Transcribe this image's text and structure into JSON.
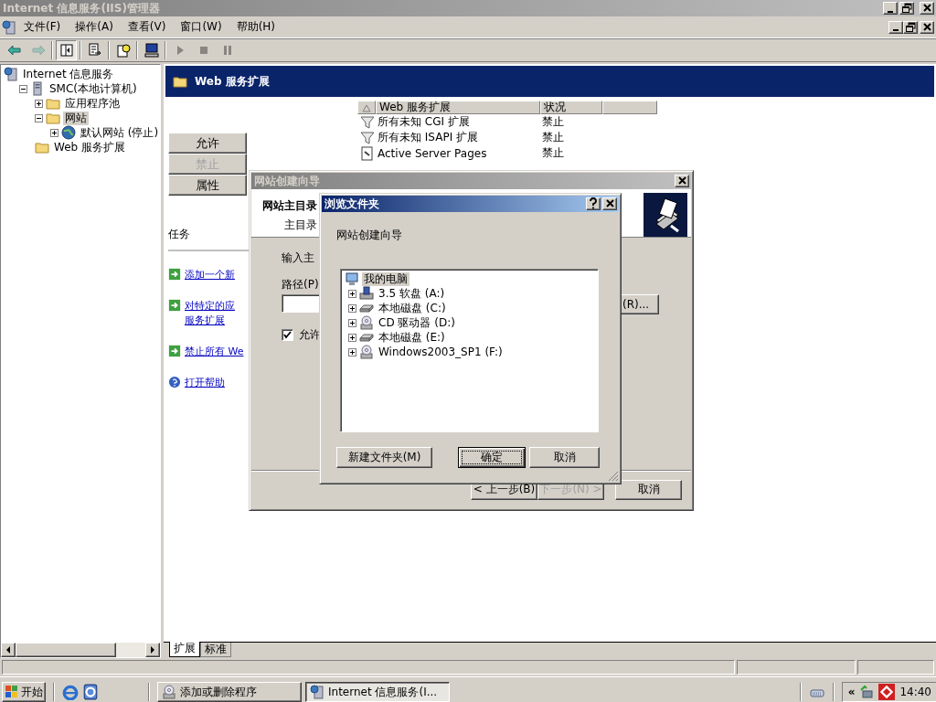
{
  "window": {
    "title": "Internet 信息服务(IIS)管理器",
    "active": false
  },
  "menus": [
    "文件(F)",
    "操作(A)",
    "查看(V)",
    "窗口(W)",
    "帮助(H)"
  ],
  "toolbar": [
    {
      "kind": "back",
      "disabled": false,
      "pressed": false
    },
    {
      "kind": "forward",
      "disabled": true,
      "pressed": false
    },
    {
      "kind": "separator"
    },
    {
      "kind": "tree-toggle",
      "disabled": false,
      "pressed": true
    },
    {
      "kind": "separator"
    },
    {
      "kind": "export",
      "disabled": false,
      "pressed": false
    },
    {
      "kind": "separator"
    },
    {
      "kind": "help",
      "disabled": false,
      "pressed": false
    },
    {
      "kind": "separator"
    },
    {
      "kind": "computer",
      "disabled": false,
      "pressed": false
    },
    {
      "kind": "separator"
    },
    {
      "kind": "play",
      "disabled": true,
      "pressed": false
    },
    {
      "kind": "stop",
      "disabled": true,
      "pressed": false
    },
    {
      "kind": "pause",
      "disabled": true,
      "pressed": false
    }
  ],
  "tree": [
    {
      "label": "Internet 信息服务",
      "kind": "root",
      "selected": false,
      "children": [
        {
          "label": "SMC(本地计算机)",
          "kind": "server",
          "expanded": true,
          "selected": false,
          "children": [
            {
              "label": "应用程序池",
              "kind": "folder",
              "expanded": false,
              "selected": false
            },
            {
              "label": "网站",
              "kind": "folder",
              "expanded": true,
              "selected": true,
              "children": [
                {
                  "label": "默认网站 (停止)",
                  "kind": "site",
                  "expanded": false,
                  "selected": false
                }
              ]
            },
            {
              "label": "Web 服务扩展",
              "kind": "folder",
              "selected": false
            }
          ]
        }
      ]
    }
  ],
  "panel": {
    "title": "Web 服务扩展",
    "actions": [
      {
        "label": "允许",
        "disabled": false
      },
      {
        "label": "禁止",
        "disabled": true
      },
      {
        "label": "属性",
        "disabled": false
      }
    ],
    "tasks_heading": "任务",
    "tasks": [
      {
        "kind": "arrow",
        "lines": [
          "添加一个新"
        ]
      },
      {
        "kind": "arrow",
        "lines": [
          "对特定的应",
          "服务扩展"
        ]
      },
      {
        "kind": "arrow",
        "lines": [
          "禁止所有 We"
        ]
      },
      {
        "kind": "help",
        "lines": [
          "打开帮助"
        ]
      }
    ],
    "columns": [
      "Web 服务扩展",
      "状况"
    ],
    "rows": [
      {
        "kind": "filter",
        "name": "所有未知 CGI 扩展",
        "status": "禁止"
      },
      {
        "kind": "filter",
        "name": "所有未知 ISAPI 扩展",
        "status": "禁止"
      },
      {
        "kind": "document",
        "name": "Active Server Pages",
        "status": "禁止"
      }
    ],
    "tabs": [
      {
        "label": "扩展",
        "selected": true
      },
      {
        "label": "标准",
        "selected": false
      }
    ]
  },
  "wizard": {
    "title": "网站创建向导",
    "active": false,
    "heading": "网站主目录",
    "subheading": "主目录",
    "prompt": "输入主",
    "path_label": "路径(P)",
    "browse_button": "(R)...",
    "checkbox": {
      "label": "允许",
      "checked": true
    },
    "buttons": [
      {
        "label": "< 上一步(B)",
        "disabled": false
      },
      {
        "label": "下一步(N) >",
        "disabled": true
      },
      {
        "label": "取消",
        "disabled": false
      }
    ]
  },
  "browse_dialog": {
    "title": "浏览文件夹",
    "description": "网站创建向导",
    "tree": [
      {
        "label": "我的电脑",
        "kind": "computer",
        "selected": true,
        "children": [
          {
            "label": "3.5 软盘 (A:)",
            "kind": "floppy",
            "expanded": false,
            "selected": false
          },
          {
            "label": "本地磁盘 (C:)",
            "kind": "disk",
            "expanded": false,
            "selected": false
          },
          {
            "label": "CD 驱动器 (D:)",
            "kind": "cd",
            "expanded": false,
            "selected": false
          },
          {
            "label": "本地磁盘 (E:)",
            "kind": "disk",
            "expanded": false,
            "selected": false
          },
          {
            "label": "Windows2003_SP1 (F:)",
            "kind": "cd",
            "expanded": false,
            "selected": false
          }
        ]
      }
    ],
    "buttons": [
      {
        "label": "新建文件夹(M)",
        "default": false
      },
      {
        "label": "确定",
        "default": true
      },
      {
        "label": "取消",
        "default": false
      }
    ]
  },
  "taskbar": {
    "start": "开始",
    "tasks": [
      {
        "label": "添加或删除程序",
        "selected": false
      },
      {
        "label": "Internet 信息服务(I...",
        "selected": true
      }
    ],
    "show_hidden": "«",
    "clock": "14:40"
  }
}
